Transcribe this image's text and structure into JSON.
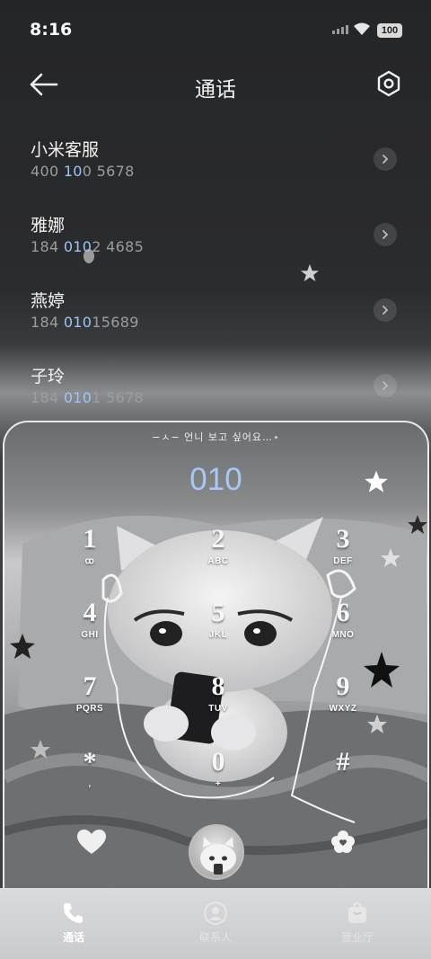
{
  "status_bar": {
    "time": "8:16",
    "battery": "100"
  },
  "header": {
    "title": "通话"
  },
  "contacts": [
    {
      "name": "小米客服",
      "number": "400 100 5678",
      "match": [
        "400 ",
        "10",
        "0 5678"
      ]
    },
    {
      "name": "雅娜",
      "number": "184 0102 4685",
      "match": [
        "184 ",
        "010",
        "2 4685"
      ]
    },
    {
      "name": "燕婷",
      "number": "184 01015689",
      "match": [
        "184 ",
        "010",
        "15689"
      ]
    },
    {
      "name": "子玲",
      "number": "184 0101 5678",
      "match": [
        "184 ",
        "010",
        "1 5678"
      ]
    }
  ],
  "dialer": {
    "caption": "−ㅅ− 언니 보고 싶어요…⋆",
    "input": "010",
    "keys": [
      {
        "digit": "1",
        "letters": "ꝏ"
      },
      {
        "digit": "2",
        "letters": "ABC"
      },
      {
        "digit": "3",
        "letters": "DEF"
      },
      {
        "digit": "4",
        "letters": "GHI"
      },
      {
        "digit": "5",
        "letters": "JKL"
      },
      {
        "digit": "6",
        "letters": "MNO"
      },
      {
        "digit": "7",
        "letters": "PQRS"
      },
      {
        "digit": "8",
        "letters": "TUV"
      },
      {
        "digit": "9",
        "letters": "WXYZ"
      },
      {
        "digit": "*",
        "letters": ","
      },
      {
        "digit": "0",
        "letters": "+"
      },
      {
        "digit": "#",
        "letters": ""
      }
    ]
  },
  "tabs": [
    {
      "label": "通话",
      "icon": "phone-icon",
      "active": true
    },
    {
      "label": "联系人",
      "icon": "person-icon",
      "active": false
    },
    {
      "label": "营业厅",
      "icon": "bag-icon",
      "active": false
    }
  ],
  "colors": {
    "highlight": "#9fc4f3",
    "digits": "#a8c8f3"
  }
}
